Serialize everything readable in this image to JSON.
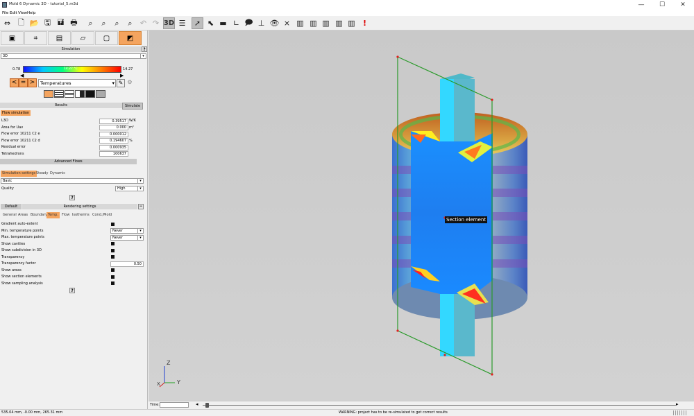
{
  "window": {
    "title": "Mold 6 Dynamic 3D - tutorial_5.m3d",
    "minimize": "—",
    "maximize": "☐",
    "close": "✕"
  },
  "menu": [
    "File",
    "Edit",
    "View",
    "Help"
  ],
  "toolbar": {
    "view_3d": "3D",
    "warning": "!"
  },
  "panel": {
    "header": "Simulation",
    "view_mode": "3D",
    "help": "?",
    "colorbar": {
      "min": "0.78",
      "mid": "14.27 °C",
      "max": "14.27",
      "colors": [
        "#1010ff",
        "#00c8ff",
        "#00ff80",
        "#ffff00",
        "#ff8000",
        "#ff0000"
      ]
    },
    "nav_prev": "<",
    "nav_eq": "=",
    "nav_next": ">",
    "quantity": "Temperatures",
    "results_label": "Results",
    "simulate_button": "Simulate",
    "flow_tab": "Flow simulation",
    "flow_rows": [
      {
        "label": "L3D",
        "value": "0.39517",
        "unit": "W/K"
      },
      {
        "label": "Area for Uav",
        "value": "0.000",
        "unit": "m²"
      },
      {
        "label": "Flow error 10211 C2 e",
        "value": "0.000012",
        "unit": ""
      },
      {
        "label": "Flow error 10211 C2 d",
        "value": "0.194607",
        "unit": "%"
      },
      {
        "label": "Residual error",
        "value": "0.000935",
        "unit": ""
      },
      {
        "label": "Tetrahedrons",
        "value": "100637",
        "unit": ""
      }
    ],
    "advanced_button": "Advanced Flows",
    "sim_tabs": [
      "Simulation settings",
      "Steady",
      "Dynamic"
    ],
    "mode_value": "Basic",
    "quality_label": "Quality",
    "quality_value": "High",
    "default_button": "Default",
    "rendering_label": "Rendering settings",
    "collapse": "−",
    "render_tabs": [
      "General",
      "Areas",
      "Boundary",
      "Temp.",
      "Flow",
      "Isotherms",
      "Cond./Mold"
    ],
    "render_rows": [
      {
        "label": "Gradient auto-extent",
        "kind": "cb"
      },
      {
        "label": "Min. temperature points",
        "kind": "dd",
        "value": "Never"
      },
      {
        "label": "Max. temperature points",
        "kind": "dd",
        "value": "Never"
      },
      {
        "label": "Show cavities",
        "kind": "cb"
      },
      {
        "label": "Show subdivision in 3D",
        "kind": "cb"
      },
      {
        "label": "Transparency",
        "kind": "cb"
      },
      {
        "label": "Transparency factor",
        "kind": "field",
        "value": "0.50"
      },
      {
        "label": "Show areas",
        "kind": "cb"
      },
      {
        "label": "Show section elements",
        "kind": "cb"
      },
      {
        "label": "Show sampling analysis",
        "kind": "cb"
      }
    ]
  },
  "viewport": {
    "tooltip": "Section element",
    "axis_z": "Z",
    "axis_x": "X",
    "axis_y": "Y"
  },
  "timebar": {
    "label": "Time:"
  },
  "status": {
    "coords": "535.04 mm, -0.00 mm, 265.31 mm",
    "warning": "WARNING: project has to be re-simulated to get correct results"
  }
}
